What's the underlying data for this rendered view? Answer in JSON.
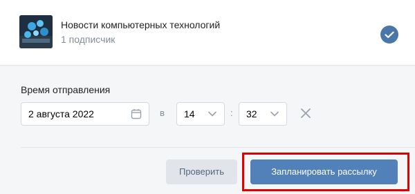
{
  "community": {
    "name": "Новости компьютерных технологий",
    "subscribers": "1 подписчик",
    "selected": true
  },
  "schedule": {
    "label": "Время отправления",
    "date_value": "2 августа 2022",
    "in_label": "в",
    "hour_value": "14",
    "separator": ":",
    "minute_value": "32"
  },
  "actions": {
    "check_label": "Проверить",
    "schedule_label": "Запланировать рассылку"
  },
  "colors": {
    "accent": "#5181b8",
    "highlight": "#e10000",
    "badge": "#4a76a8"
  },
  "icons": [
    "community-avatar",
    "check-icon",
    "calendar-icon",
    "chevron-down-icon",
    "close-icon"
  ]
}
